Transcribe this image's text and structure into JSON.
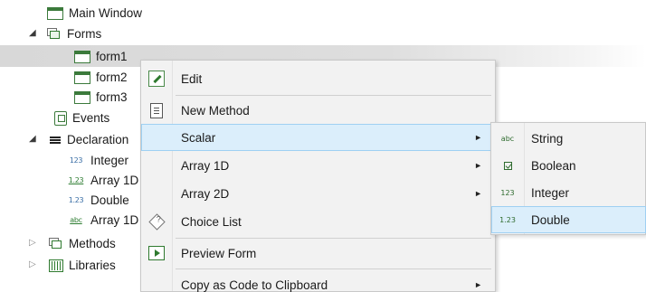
{
  "tree": {
    "main_window": "Main Window",
    "forms": "Forms",
    "form1": "form1",
    "form2": "form2",
    "form3": "form3",
    "events": "Events",
    "declarations": "Declaration",
    "decl_items": [
      {
        "badge": "123",
        "label": "Integer"
      },
      {
        "badge": "1.23",
        "label": "Array 1D"
      },
      {
        "badge": "1.23",
        "label": "Double"
      },
      {
        "badge": "abc",
        "label": "Array 1D"
      }
    ],
    "methods": "Methods",
    "libraries": "Libraries"
  },
  "context_menu": {
    "items": [
      {
        "label": "Edit",
        "icon": "edit-icon"
      },
      {
        "label": "New Method",
        "icon": "new-method-icon"
      },
      {
        "label": "Scalar",
        "has_submenu": true
      },
      {
        "label": "Array 1D",
        "has_submenu": true
      },
      {
        "label": "Array 2D",
        "has_submenu": true
      },
      {
        "label": "Choice List",
        "icon": "choice-list-icon"
      },
      {
        "label": "Preview Form",
        "icon": "preview-icon"
      },
      {
        "label": "Copy as Code to Clipboard",
        "has_submenu": true
      }
    ],
    "submenu_arrow": "►"
  },
  "submenu": {
    "items": [
      {
        "badge": "abc",
        "label": "String"
      },
      {
        "badge": "",
        "label": "Boolean"
      },
      {
        "badge": "123",
        "label": "Integer"
      },
      {
        "badge": "1.23",
        "label": "Double"
      }
    ]
  },
  "colors": {
    "highlight": "#dbeefb",
    "highlight_border": "#9fd0f2",
    "menu_bg": "#f2f2f2",
    "icon_green": "#2f7a2f"
  }
}
